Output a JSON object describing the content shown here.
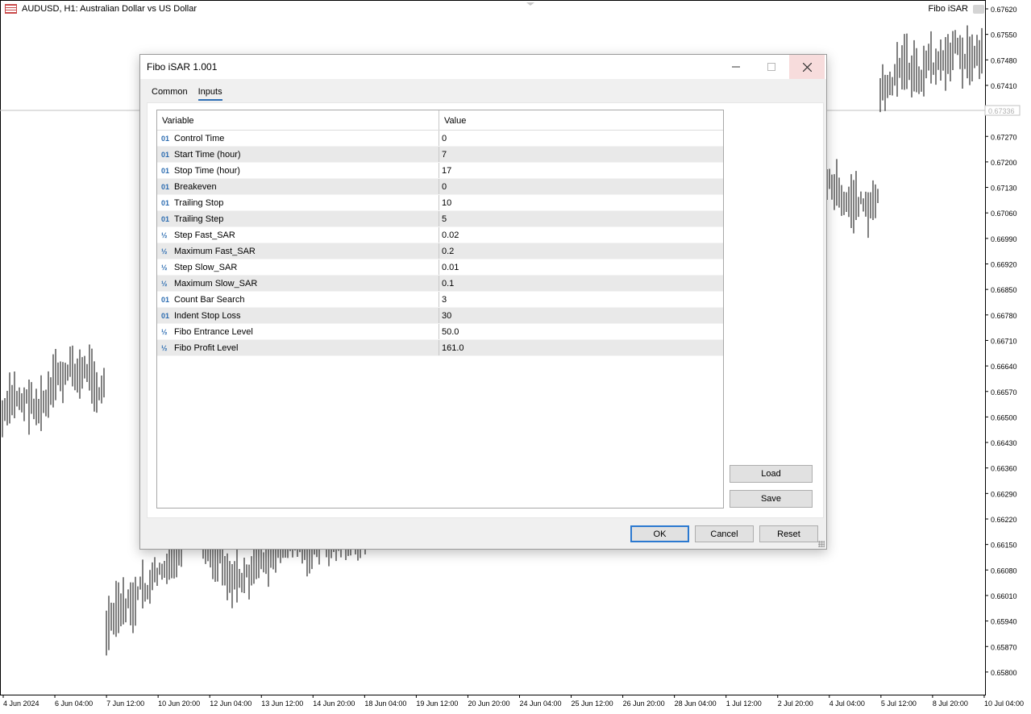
{
  "chart": {
    "symbol_label": "AUDUSD, H1:  Australian Dollar vs US Dollar",
    "indicator_label": "Fibo iSAR",
    "current_price": "0.67336",
    "price_labels": [
      "0.67620",
      "0.67550",
      "0.67480",
      "0.67410",
      "0.67270",
      "0.67200",
      "0.67130",
      "0.67060",
      "0.66990",
      "0.66920",
      "0.66850",
      "0.66780",
      "0.66710",
      "0.66640",
      "0.66570",
      "0.66500",
      "0.66430",
      "0.66360",
      "0.66290",
      "0.66220",
      "0.66150",
      "0.66080",
      "0.66010",
      "0.65940",
      "0.65870",
      "0.65800"
    ],
    "time_labels": [
      "4 Jun 2024",
      "6 Jun 04:00",
      "7 Jun 12:00",
      "10 Jun 20:00",
      "12 Jun 04:00",
      "13 Jun 12:00",
      "14 Jun 20:00",
      "18 Jun 04:00",
      "19 Jun 12:00",
      "20 Jun 20:00",
      "24 Jun 04:00",
      "25 Jun 12:00",
      "26 Jun 20:00",
      "28 Jun 04:00",
      "1 Jul 12:00",
      "2 Jul 20:00",
      "4 Jul 04:00",
      "5 Jul 12:00",
      "8 Jul 20:00",
      "10 Jul 04:00"
    ],
    "colors": {
      "bars": "#000000",
      "bid_line": "#c0c0c0",
      "grid_text": "#000000"
    }
  },
  "dialog": {
    "title": "Fibo iSAR 1.001",
    "tabs": [
      {
        "label": "Common",
        "active": false
      },
      {
        "label": "Inputs",
        "active": true
      }
    ],
    "columns": {
      "variable": "Variable",
      "value": "Value"
    },
    "rows": [
      {
        "icon": "01",
        "variable": "Control Time",
        "value": "0"
      },
      {
        "icon": "01",
        "variable": "Start Time (hour)",
        "value": "7"
      },
      {
        "icon": "01",
        "variable": "Stop Time (hour)",
        "value": "17"
      },
      {
        "icon": "01",
        "variable": "Breakeven",
        "value": "0"
      },
      {
        "icon": "01",
        "variable": "Trailing Stop",
        "value": "10"
      },
      {
        "icon": "01",
        "variable": "Trailing Step",
        "value": "5"
      },
      {
        "icon": "½",
        "variable": "Step Fast_SAR",
        "value": "0.02"
      },
      {
        "icon": "½",
        "variable": "Maximum Fast_SAR",
        "value": "0.2"
      },
      {
        "icon": "½",
        "variable": "Step Slow_SAR",
        "value": "0.01"
      },
      {
        "icon": "½",
        "variable": "Maximum Slow_SAR",
        "value": "0.1"
      },
      {
        "icon": "01",
        "variable": "Count Bar Search",
        "value": "3"
      },
      {
        "icon": "01",
        "variable": "Indent Stop Loss",
        "value": "30"
      },
      {
        "icon": "½",
        "variable": "Fibo Entrance Level",
        "value": "50.0"
      },
      {
        "icon": "½",
        "variable": "Fibo Profit Level",
        "value": "161.0"
      }
    ],
    "buttons": {
      "load": "Load",
      "save": "Save",
      "ok": "OK",
      "cancel": "Cancel",
      "reset": "Reset"
    },
    "accent_color": "#2b79d0"
  }
}
